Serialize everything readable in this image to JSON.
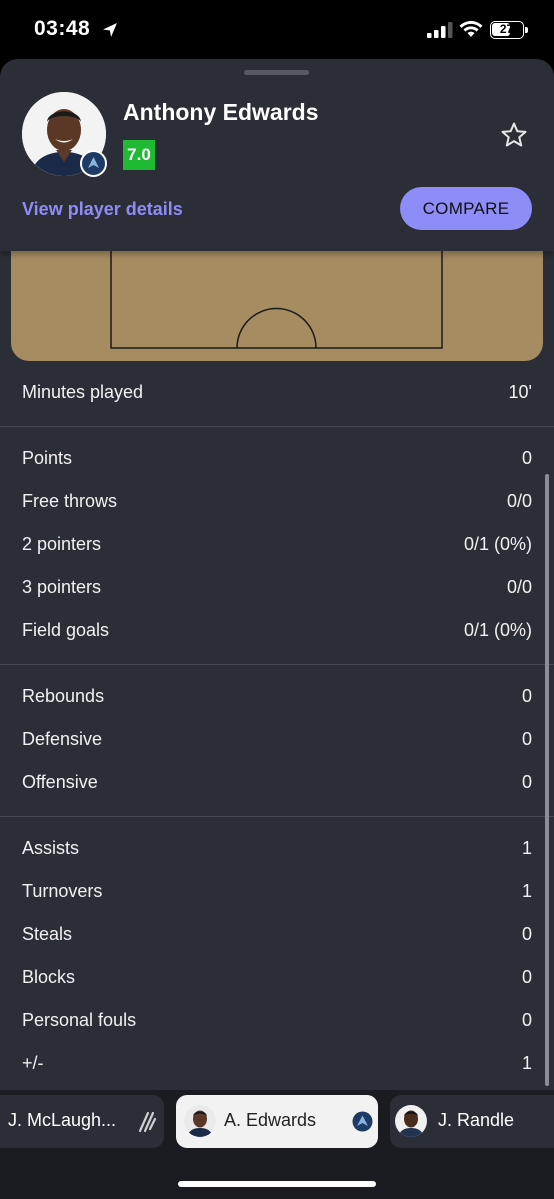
{
  "status_bar": {
    "time": "03:48",
    "battery": "27"
  },
  "player": {
    "name": "Anthony Edwards",
    "rating": "7.0",
    "details_link": "View player details",
    "compare_label": "COMPARE"
  },
  "colors": {
    "accent": "#8e8cf7",
    "rating_green": "#1fb934",
    "court": "#a68d61",
    "sheet_bg": "#2b2e36"
  },
  "stats": {
    "minutes": [
      {
        "label": "Minutes played",
        "value": "10'"
      }
    ],
    "scoring": [
      {
        "label": "Points",
        "value": "0"
      },
      {
        "label": "Free throws",
        "value": "0/0"
      },
      {
        "label": "2 pointers",
        "value": "0/1 (0%)"
      },
      {
        "label": "3 pointers",
        "value": "0/0"
      },
      {
        "label": "Field goals",
        "value": "0/1 (0%)"
      }
    ],
    "rebounding": [
      {
        "label": "Rebounds",
        "value": "0"
      },
      {
        "label": "Defensive",
        "value": "0"
      },
      {
        "label": "Offensive",
        "value": "0"
      }
    ],
    "other": [
      {
        "label": "Assists",
        "value": "1"
      },
      {
        "label": "Turnovers",
        "value": "1"
      },
      {
        "label": "Steals",
        "value": "0"
      },
      {
        "label": "Blocks",
        "value": "0"
      },
      {
        "label": "Personal fouls",
        "value": "0"
      },
      {
        "label": "+/-",
        "value": "1"
      }
    ]
  },
  "player_switcher": [
    {
      "name": "J. McLaugh...",
      "team_icon": "spurs-icon"
    },
    {
      "name": "A. Edwards",
      "team_icon": "timberwolves-icon",
      "selected": true
    },
    {
      "name": "J. Randle",
      "team_icon": "none"
    }
  ],
  "icons": [
    "location-arrow-icon",
    "signal-icon",
    "wifi-icon",
    "battery-icon",
    "star-icon"
  ]
}
